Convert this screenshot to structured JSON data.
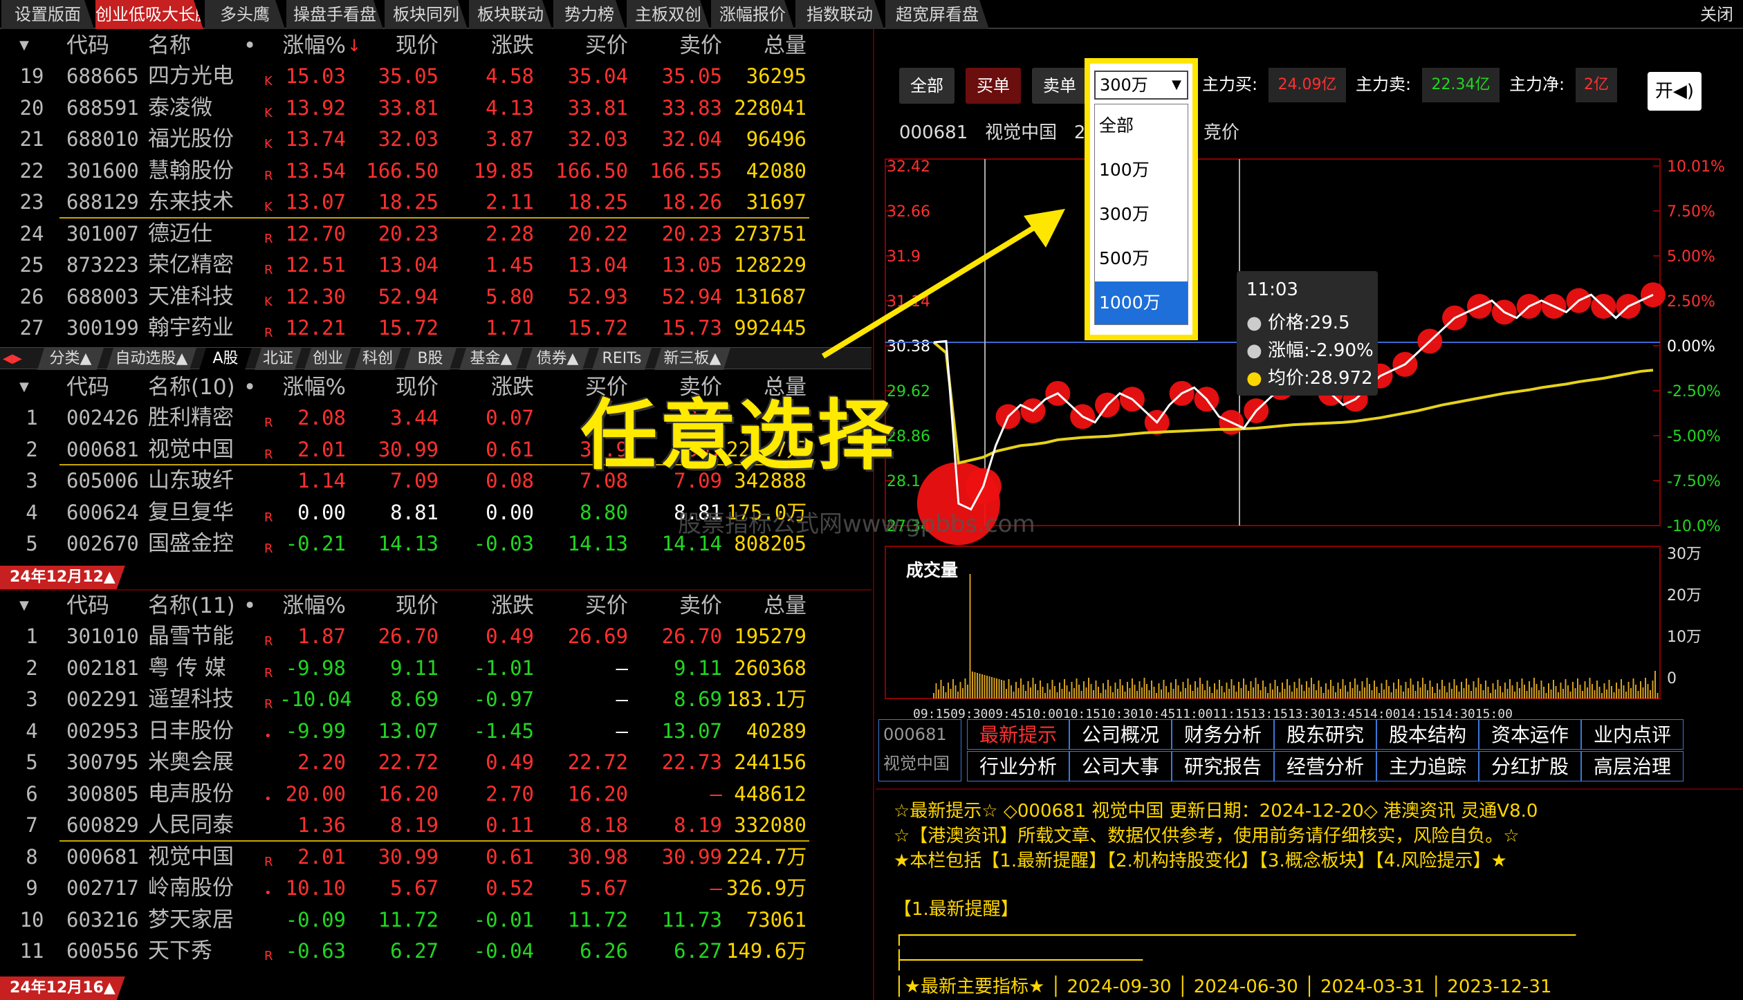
{
  "top_tabs": [
    "设置版面",
    "创业低吸大长腿",
    "多头鹰",
    "操盘手看盘",
    "板块同列",
    "板块联动",
    "势力榜",
    "主板双创",
    "涨幅报价",
    "指数联动",
    "超宽屏看盘"
  ],
  "close_label": "关闭",
  "table1": {
    "headers": [
      "代码",
      "名称",
      "•",
      "涨幅%",
      "现价",
      "涨跌",
      "买价",
      "卖价",
      "总量"
    ],
    "sort_arrow": "↓",
    "rows": [
      {
        "idx": "19",
        "code": "688665",
        "name": "四方光电",
        "tag": "K",
        "pct": "15.03",
        "price": "35.05",
        "chg": "4.58",
        "bid": "35.04",
        "ask": "35.05",
        "vol": "36295"
      },
      {
        "idx": "20",
        "code": "688591",
        "name": "泰凌微",
        "tag": "K",
        "pct": "13.92",
        "price": "33.81",
        "chg": "4.13",
        "bid": "33.81",
        "ask": "33.83",
        "vol": "228041"
      },
      {
        "idx": "21",
        "code": "688010",
        "name": "福光股份",
        "tag": "K",
        "pct": "13.74",
        "price": "32.03",
        "chg": "3.87",
        "bid": "32.03",
        "ask": "32.04",
        "vol": "96496"
      },
      {
        "idx": "22",
        "code": "301600",
        "name": "慧翰股份",
        "tag": "R",
        "pct": "13.54",
        "price": "166.50",
        "chg": "19.85",
        "bid": "166.50",
        "ask": "166.55",
        "vol": "42080"
      },
      {
        "idx": "23",
        "code": "688129",
        "name": "东来技术",
        "tag": "K",
        "pct": "13.07",
        "price": "18.25",
        "chg": "2.11",
        "bid": "18.25",
        "ask": "18.26",
        "vol": "31697"
      },
      {
        "idx": "24",
        "code": "301007",
        "name": "德迈仕",
        "tag": "R",
        "pct": "12.70",
        "price": "20.23",
        "chg": "2.28",
        "bid": "20.22",
        "ask": "20.23",
        "vol": "273751"
      },
      {
        "idx": "25",
        "code": "873223",
        "name": "荣亿精密",
        "tag": "R",
        "pct": "12.51",
        "price": "13.04",
        "chg": "1.45",
        "bid": "13.04",
        "ask": "13.05",
        "vol": "128229"
      },
      {
        "idx": "26",
        "code": "688003",
        "name": "天准科技",
        "tag": "K",
        "pct": "12.30",
        "price": "52.94",
        "chg": "5.80",
        "bid": "52.93",
        "ask": "52.94",
        "vol": "131687"
      },
      {
        "idx": "27",
        "code": "300199",
        "name": "翰宇药业",
        "tag": "R",
        "pct": "12.21",
        "price": "15.72",
        "chg": "1.71",
        "bid": "15.72",
        "ask": "15.73",
        "vol": "992445"
      }
    ]
  },
  "categories": [
    "分类▲",
    "自动选股▲",
    "A股",
    "北证",
    "创业",
    "科创",
    "B股",
    "基金▲",
    "债券▲",
    "REITs",
    "新三板▲"
  ],
  "cat_arrows": "◀▶",
  "table2": {
    "headers": [
      "代码",
      "名称(10)",
      "•",
      "涨幅%",
      "现价",
      "涨跌",
      "买价",
      "卖价",
      "总量"
    ],
    "rows": [
      {
        "idx": "1",
        "code": "002426",
        "name": "胜利精密",
        "tag": "R",
        "pct": "2.08",
        "price": "3.44",
        "chg": "0.07",
        "bid": "",
        "ask": "3.3",
        "vol": ""
      },
      {
        "idx": "2",
        "code": "000681",
        "name": "视觉中国",
        "tag": "R",
        "pct": "2.01",
        "price": "30.99",
        "chg": "0.61",
        "bid": "30.9",
        "ask": "30.",
        "vol": "224.7万"
      },
      {
        "idx": "3",
        "code": "605006",
        "name": "山东玻纤",
        "tag": "",
        "pct": "1.14",
        "price": "7.09",
        "chg": "0.08",
        "bid": "7.08",
        "ask": "7.09",
        "vol": "342888"
      },
      {
        "idx": "4",
        "code": "600624",
        "name": "复旦复华",
        "tag": "R",
        "pct": "0.00",
        "price": "8.81",
        "chg": "0.00",
        "bid": "8.80",
        "ask": "8.81",
        "vol": "175.0万"
      },
      {
        "idx": "5",
        "code": "002670",
        "name": "国盛金控",
        "tag": "R",
        "pct": "-0.21",
        "price": "14.13",
        "chg": "-0.03",
        "bid": "14.13",
        "ask": "14.14",
        "vol": "808205"
      }
    ]
  },
  "date_badge1": "24年12月12▲",
  "table3": {
    "headers": [
      "代码",
      "名称(11)",
      "•",
      "涨幅%",
      "现价",
      "涨跌",
      "买价",
      "卖价",
      "总量"
    ],
    "rows": [
      {
        "idx": "1",
        "code": "301010",
        "name": "晶雪节能",
        "tag": "R",
        "pct": "1.87",
        "price": "26.70",
        "chg": "0.49",
        "bid": "26.69",
        "ask": "26.70",
        "vol": "195279"
      },
      {
        "idx": "2",
        "code": "002181",
        "name": "粤 传 媒",
        "tag": "R",
        "pct": "-9.98",
        "price": "9.11",
        "chg": "-1.01",
        "bid": "–",
        "ask": "9.11",
        "vol": "260368"
      },
      {
        "idx": "3",
        "code": "002291",
        "name": "遥望科技",
        "tag": "R",
        "pct": "-10.04",
        "price": "8.69",
        "chg": "-0.97",
        "bid": "–",
        "ask": "8.69",
        "vol": "183.1万"
      },
      {
        "idx": "4",
        "code": "002953",
        "name": "日丰股份",
        "tag": "•",
        "pct": "-9.99",
        "price": "13.07",
        "chg": "-1.45",
        "bid": "–",
        "ask": "13.07",
        "vol": "40289"
      },
      {
        "idx": "5",
        "code": "300795",
        "name": "米奥会展",
        "tag": "",
        "pct": "2.20",
        "price": "22.72",
        "chg": "0.49",
        "bid": "22.72",
        "ask": "22.73",
        "vol": "244156"
      },
      {
        "idx": "6",
        "code": "300805",
        "name": "电声股份",
        "tag": "•",
        "pct": "20.00",
        "price": "16.20",
        "chg": "2.70",
        "bid": "16.20",
        "ask": "–",
        "vol": "448612"
      },
      {
        "idx": "7",
        "code": "600829",
        "name": "人民同泰",
        "tag": "",
        "pct": "1.36",
        "price": "8.19",
        "chg": "0.11",
        "bid": "8.18",
        "ask": "8.19",
        "vol": "332080"
      },
      {
        "idx": "8",
        "code": "000681",
        "name": "视觉中国",
        "tag": "R",
        "pct": "2.01",
        "price": "30.99",
        "chg": "0.61",
        "bid": "30.98",
        "ask": "30.99",
        "vol": "224.7万"
      },
      {
        "idx": "9",
        "code": "002717",
        "name": "岭南股份",
        "tag": "•",
        "pct": "10.10",
        "price": "5.67",
        "chg": "0.52",
        "bid": "5.67",
        "ask": "–",
        "vol": "326.9万"
      },
      {
        "idx": "10",
        "code": "603216",
        "name": "梦天家居",
        "tag": "",
        "pct": "-0.09",
        "price": "11.72",
        "chg": "-0.01",
        "bid": "11.72",
        "ask": "11.73",
        "vol": "73061"
      },
      {
        "idx": "11",
        "code": "600556",
        "name": "天下秀",
        "tag": "R",
        "pct": "-0.63",
        "price": "6.27",
        "chg": "-0.04",
        "bid": "6.26",
        "ask": "6.27",
        "vol": "149.6万"
      }
    ]
  },
  "date_badge2": "24年12月16▲",
  "order_filter": {
    "buttons": [
      "全部",
      "买单",
      "卖单"
    ],
    "selected": "300万",
    "options": [
      "全部",
      "100万",
      "300万",
      "500万",
      "1000万"
    ],
    "highlighted": "1000万"
  },
  "main_force": {
    "buy_label": "主力买:",
    "buy_value": "24.09亿",
    "sell_label": "主力卖:",
    "sell_value": "22.34亿",
    "net_label": "主力净:",
    "net_value": "2亿"
  },
  "sound_button": "开◀)",
  "stock_line": {
    "code": "000681",
    "name": "视觉中国",
    "extra": "2",
    "auction": "竞价"
  },
  "chart_data": {
    "type": "line",
    "left_axis": [
      "32.42",
      "32.66",
      "31.9",
      "31.14",
      "30.38",
      "29.62",
      "28.86",
      "28.1",
      "27.34"
    ],
    "right_axis": [
      "10.01%",
      "7.50%",
      "5.00%",
      "2.50%",
      "0.00%",
      "-2.50%",
      "-5.00%",
      "-7.50%",
      "-10.0%"
    ],
    "ylim": [
      27.34,
      33.42
    ],
    "prev_close": 30.38,
    "price_series": [
      30.38,
      30.4,
      27.6,
      27.5,
      27.9,
      28.6,
      29.1,
      29.3,
      29.2,
      29.4,
      29.5,
      29.3,
      29.1,
      29.0,
      29.3,
      29.5,
      29.4,
      29.2,
      29.0,
      29.3,
      29.5,
      29.6,
      29.4,
      29.1,
      29.0,
      28.9,
      29.2,
      29.4,
      29.6,
      29.8,
      30.1,
      29.9,
      29.5,
      29.3,
      29.4,
      29.6,
      29.8,
      29.9,
      30.0,
      30.2,
      30.4,
      30.6,
      30.8,
      30.9,
      31.0,
      31.1,
      30.9,
      30.8,
      31.0,
      31.1,
      31.0,
      30.9,
      31.1,
      31.2,
      31.0,
      30.8,
      31.0,
      31.1,
      31.2
    ],
    "avg_series": [
      30.38,
      30.2,
      28.3,
      28.35,
      28.4,
      28.5,
      28.55,
      28.6,
      28.62,
      28.65,
      28.7,
      28.72,
      28.74,
      28.75,
      28.76,
      28.78,
      28.8,
      28.82,
      28.83,
      28.84,
      28.85,
      28.86,
      28.87,
      28.88,
      28.88,
      28.89,
      28.9,
      28.92,
      28.94,
      28.96,
      28.97,
      28.98,
      28.99,
      29.0,
      29.02,
      29.05,
      29.08,
      29.12,
      29.16,
      29.2,
      29.25,
      29.3,
      29.34,
      29.38,
      29.42,
      29.46,
      29.5,
      29.53,
      29.56,
      29.6,
      29.63,
      29.66,
      29.7,
      29.73,
      29.76,
      29.8,
      29.84,
      29.88,
      29.9
    ],
    "tooltip": {
      "time": "11:03",
      "price": "价格:29.5",
      "chg": "涨幅:-2.90%",
      "avg": "均价:28.972"
    },
    "volume_title": "成交量",
    "volume_axis": [
      "30万",
      "20万",
      "10万",
      "0"
    ],
    "x_ticks": "09:1509:3009:4510:0010:1510:3010:4511:0011:1513:1513:3013:4514:0014:1514:3015:00"
  },
  "watermark": "股票指标公式网www.gpbbs.com",
  "overlay_text": "任意选择",
  "f10": {
    "code": "000681",
    "name": "视觉中国",
    "row1": [
      "最新提示",
      "公司概况",
      "财务分析",
      "股东研究",
      "股本结构",
      "资本运作",
      "业内点评"
    ],
    "row2": [
      "行业分析",
      "公司大事",
      "研究报告",
      "经营分析",
      "主力追踪",
      "分红扩股",
      "高层治理"
    ]
  },
  "info_lines": [
    "☆最新提示☆ ◇000681 视觉中国 更新日期：2024-12-20◇ 港澳资讯 灵通V8.0",
    "☆【港澳资讯】所载文章、数据仅供参考，使用前务请仔细核实，风险自负。☆",
    "★本栏包括【1.最新提醒】【2.机构持股变化】【3.概念板块】【4.风险提示】★",
    "【1.最新提醒】",
    "┌──────────────────────────────────────────────────────────────",
    "├──────────────────────",
    "│★最新主要指标★  │   2024-09-30  │   2024-06-30  │   2024-03-31  │   2023-12-31"
  ],
  "colors": {
    "up": "#ff3030",
    "down": "#22d622",
    "accent": "#c62020",
    "highlight": "#ffe600"
  }
}
